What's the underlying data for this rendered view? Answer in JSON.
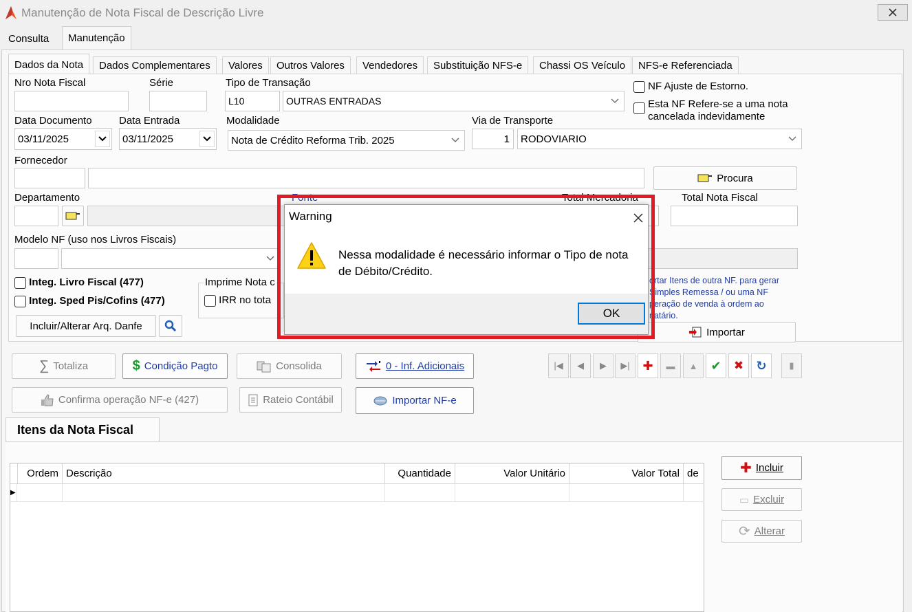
{
  "window": {
    "title": "Manutenção de Nota Fiscal de Descrição Livre"
  },
  "main_tabs": [
    "Consulta",
    "Manutenção"
  ],
  "sub_tabs": [
    "Dados da Nota",
    "Dados Complementares",
    "Valores",
    "Outros Valores",
    "Vendedores",
    "Substituição NFS-e",
    "Chassi OS Veículo",
    "NFS-e Referenciada"
  ],
  "form": {
    "nro_nf_label": "Nro Nota Fiscal",
    "serie_label": "Série",
    "tipo_transacao_label": "Tipo de Transação",
    "tipo_transacao_code": "L10",
    "tipo_transacao_value": "OUTRAS ENTRADAS",
    "nf_ajuste_label": "NF Ajuste de Estorno.",
    "nf_cancelada_label_1": "Esta NF Refere-se a uma nota",
    "nf_cancelada_label_2": "cancelada indevidamente",
    "data_documento_label": "Data Documento",
    "data_documento_value": "03/11/2025",
    "data_entrada_label": "Data Entrada",
    "data_entrada_value": "03/11/2025",
    "modalidade_label": "Modalidade",
    "modalidade_value": "Nota de Crédito Reforma Trib. 2025",
    "via_transporte_label": "Via de Transporte",
    "via_transporte_code": "1",
    "via_transporte_value": "RODOVIARIO",
    "fornecedor_label": "Fornecedor",
    "procura_label": "Procura",
    "departamento_label": "Departamento",
    "fonte_label": "Fonte",
    "total_mercadoria_label": "Total Mercadoria",
    "total_nf_label": "Total Nota Fiscal",
    "modelo_nf_label": "Modelo NF (uso nos Livros Fiscais)",
    "integ_livro_label": "Integ. Livro Fiscal (477)",
    "integ_sped_label": "Integ. Sped Pis/Cofins (477)",
    "imprime_nota_label": "Imprime Nota c",
    "irr_label": "IRR no tota",
    "incluir_danfe_label": "Incluir/Alterar Arq. Danfe",
    "importar_info_1": "ortar Itens de outra NF. para gerar",
    "importar_info_2": "Simples Remessa / ou uma NF",
    "importar_info_3": "peração de venda à ordem ao",
    "importar_info_4": "natário.",
    "importar_label": "Importar"
  },
  "actions": {
    "totaliza": "Totaliza",
    "condicao_pagto": "Condição Pagto",
    "consolida": "Consolida",
    "inf_adicionais": "0 - Inf. Adicionais",
    "confirma_nfe": "Confirma operação NF-e (427)",
    "rateio_contabil": "Rateio Contábil",
    "importar_nfe": "Importar NF-e"
  },
  "items": {
    "tab_label": "Itens da Nota Fiscal",
    "columns": [
      "Ordem",
      "Descrição",
      "Quantidade",
      "Valor Unitário",
      "Valor Total",
      "de"
    ],
    "incluir": "Incluir",
    "excluir": "Excluir",
    "alterar": "Alterar"
  },
  "dialog": {
    "title": "Warning",
    "message_1": "Nessa modalidade é necessário informar o Tipo de nota",
    "message_2": "de Débito/Crédito.",
    "ok": "OK"
  },
  "colors": {
    "highlight": "#e01b24",
    "link_blue": "#1f3ca8",
    "ok_border": "#0078d7"
  }
}
